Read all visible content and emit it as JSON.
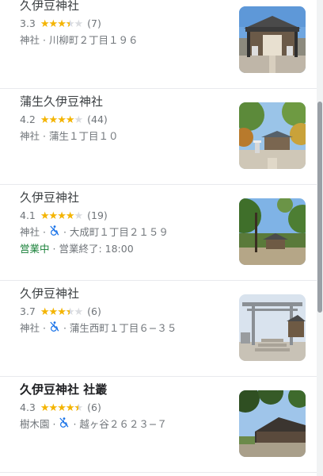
{
  "results": [
    {
      "name": "久伊豆神社",
      "rating": "3.3",
      "stars": 3.3,
      "reviews": "(7)",
      "category": "神社",
      "address": "川柳町２丁目１９６",
      "wheelchair": false,
      "open_status": "",
      "hours": ""
    },
    {
      "name": "蒲生久伊豆神社",
      "rating": "4.2",
      "stars": 4.2,
      "reviews": "(44)",
      "category": "神社",
      "address": "蒲生１丁目１０",
      "wheelchair": false,
      "open_status": "",
      "hours": ""
    },
    {
      "name": "久伊豆神社",
      "rating": "4.1",
      "stars": 4.1,
      "reviews": "(19)",
      "category": "神社",
      "address": "大成町１丁目２１５９",
      "wheelchair": true,
      "open_status": "営業中",
      "hours": "営業終了: 18:00"
    },
    {
      "name": "久伊豆神社",
      "rating": "3.7",
      "stars": 3.7,
      "reviews": "(6)",
      "category": "神社",
      "address": "蒲生西町１丁目６−３５",
      "wheelchair": true,
      "open_status": "",
      "hours": ""
    },
    {
      "name": "久伊豆神社 社叢",
      "rating": "4.3",
      "stars": 4.3,
      "reviews": "(6)",
      "category": "樹木園",
      "address": "越ヶ谷２６２３−７",
      "wheelchair": true,
      "open_status": "",
      "hours": ""
    }
  ],
  "separator": "·",
  "icons": {
    "star": "star-icon",
    "wheelchair": "wheelchair-not-accessible-icon"
  },
  "colors": {
    "star": "#f4b400",
    "open": "#188038",
    "wheelchair": "#1a73e8"
  }
}
